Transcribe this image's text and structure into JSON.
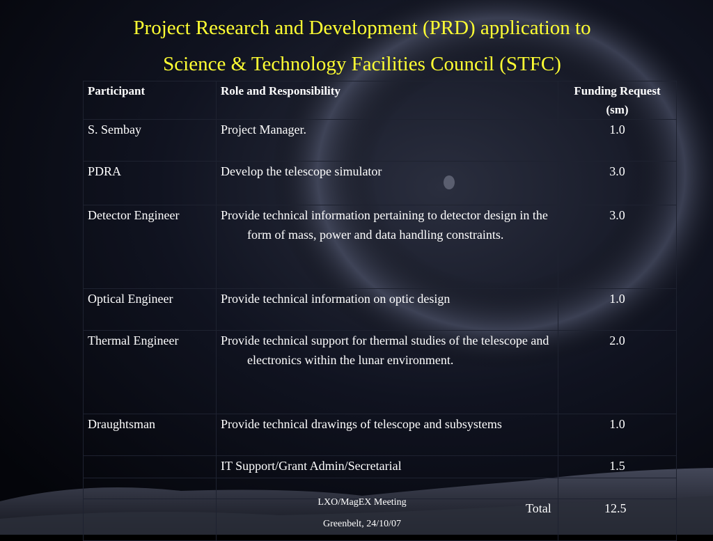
{
  "title": {
    "line1": "Project Research and Development (PRD) application to",
    "line2": "Science & Technology Facilities Council (STFC)"
  },
  "table": {
    "headers": {
      "participant": "Participant",
      "role": "Role and Responsibility",
      "funding": "Funding Request (sm)"
    },
    "rows": [
      {
        "participant": "S. Sembay",
        "role": "Project Manager.",
        "funding": "1.0"
      },
      {
        "participant": "PDRA",
        "role": "Develop the telescope simulator",
        "funding": "3.0"
      },
      {
        "participant": "Detector Engineer",
        "role": "Provide technical information pertaining to detector design in the form of mass, power and data handling constraints.",
        "funding": "3.0"
      },
      {
        "participant": "Optical Engineer",
        "role": "Provide technical information on optic design",
        "funding": "1.0"
      },
      {
        "participant": "Thermal Engineer",
        "role": "Provide technical support for thermal studies of the telescope and electronics within the lunar environment.",
        "funding": "2.0"
      },
      {
        "participant": "Draughtsman",
        "role": "Provide technical drawings of telescope and subsystems",
        "funding": "1.0"
      },
      {
        "participant": "",
        "role": "IT Support/Grant Admin/Secretarial",
        "funding": "1.5"
      }
    ],
    "total_label": "Total",
    "total_value": "12.5"
  },
  "footer": {
    "line1": "LXO/MagEX Meeting",
    "line2": "Greenbelt, 24/10/07"
  }
}
